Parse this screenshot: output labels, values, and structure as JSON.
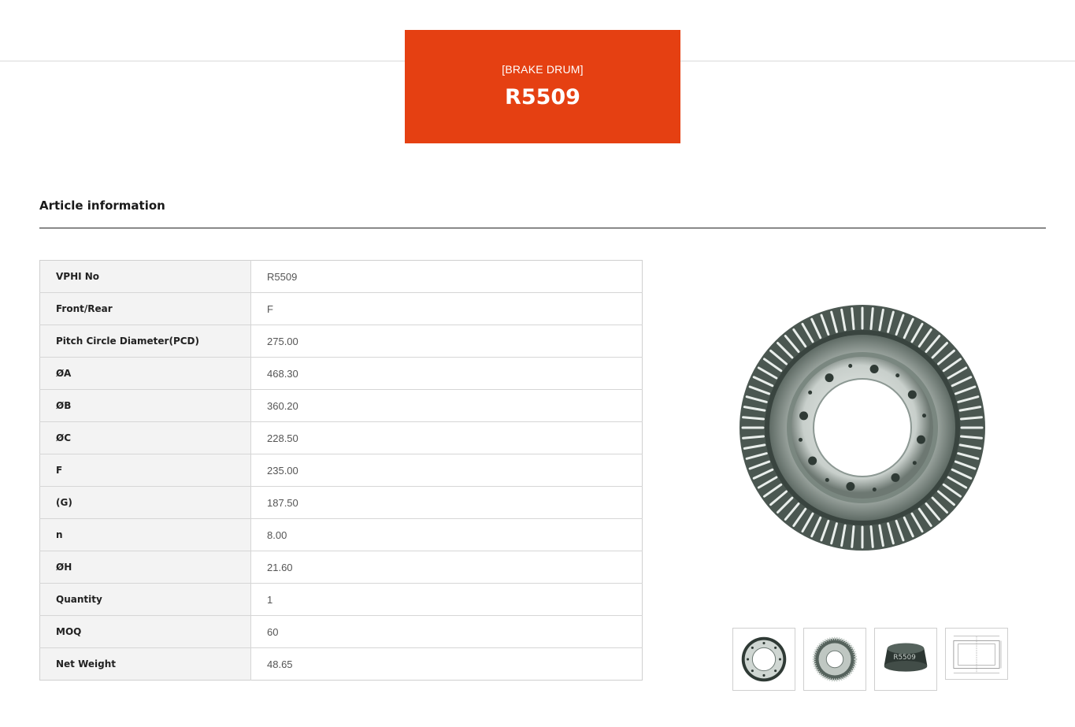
{
  "product": {
    "category": "[BRAKE DRUM]",
    "code": "R5509"
  },
  "article": {
    "title": "Article information",
    "rows": [
      {
        "label": "VPHI No",
        "value": "R5509"
      },
      {
        "label": "Front/Rear",
        "value": "F"
      },
      {
        "label": "Pitch Circle Diameter(PCD)",
        "value": "275.00"
      },
      {
        "label": "ØA",
        "value": "468.30"
      },
      {
        "label": "ØB",
        "value": "360.20"
      },
      {
        "label": "ØC",
        "value": "228.50"
      },
      {
        "label": "F",
        "value": "235.00"
      },
      {
        "label": "(G)",
        "value": "187.50"
      },
      {
        "label": "n",
        "value": "8.00"
      },
      {
        "label": "ØH",
        "value": "21.60"
      },
      {
        "label": "Quantity",
        "value": "1"
      },
      {
        "label": "MOQ",
        "value": "60"
      },
      {
        "label": "Net Weight",
        "value": "48.65"
      }
    ]
  },
  "gallery": {
    "main": "brake-drum-finned-front-view",
    "thumbnails": [
      "brake-drum-front-view",
      "brake-drum-finned-view",
      "brake-drum-side-view",
      "technical-drawing"
    ]
  },
  "colors": {
    "accent": "#e54012",
    "label_bg": "#f3f3f3",
    "border": "#d6d6d6"
  }
}
